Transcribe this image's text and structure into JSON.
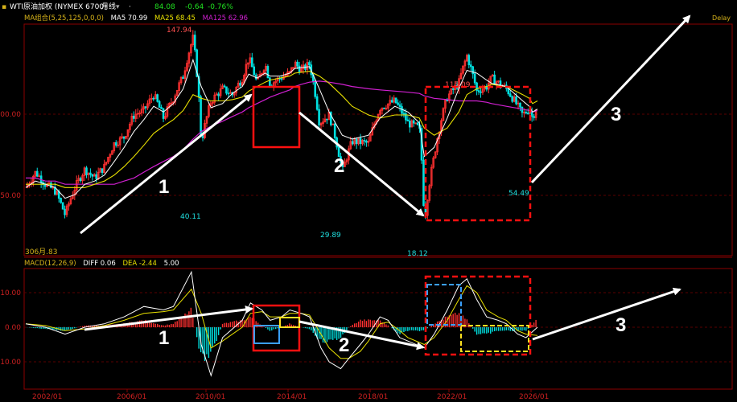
{
  "header": {
    "instrument": "WTI原油加权 (NYMEX 6700)",
    "period": "月线",
    "price": "84.08",
    "change": "-0.64",
    "change_pct": "-0.76%",
    "delay": "Delay"
  },
  "ma_legend": {
    "title": "MA组合(5,25,125,0,0,0)",
    "ma5": "MA5 70.99",
    "ma25": "MA25 68.45",
    "ma125": "MA125 62.96"
  },
  "macd_legend": {
    "title": "MACD(12,26,9)",
    "diff": "DIFF 0.06",
    "dea": "DEA -2.44",
    "macd": "5.00"
  },
  "colors": {
    "up": "#ff3030",
    "down": "#00e0e0",
    "ma5": "#ffffff",
    "ma25": "#e8e000",
    "ma125": "#d020d0",
    "annotation": "#ffffff",
    "box_red": "#ff1010",
    "box_blue": "#3aa0ff",
    "box_yellow": "#ffe020"
  },
  "chart_data": [
    {
      "type": "candlestick",
      "title": "WTI原油加权 月线",
      "yticks": [
        "100.00",
        "50.00"
      ],
      "ylim": [
        13,
        160
      ],
      "xlabels": [
        "2002/01",
        "2006/01",
        "2010/01",
        "2014/01",
        "2018/01",
        "2022/01",
        "2026/01"
      ],
      "price_labels": [
        "147.94",
        "40.11",
        "29.89",
        "18.12",
        "115.09",
        "54.49",
        "306月.83"
      ],
      "annotations": [
        "1",
        "2",
        "3"
      ],
      "x": [
        "2000/01",
        "2000/07",
        "2001/01",
        "2001/07",
        "2002/01",
        "2002/07",
        "2003/01",
        "2003/07",
        "2004/01",
        "2004/07",
        "2005/01",
        "2005/07",
        "2006/01",
        "2006/07",
        "2007/01",
        "2007/07",
        "2008/01",
        "2008/07",
        "2008/12",
        "2009/06",
        "2010/01",
        "2010/07",
        "2011/01",
        "2011/05",
        "2011/10",
        "2012/03",
        "2012/06",
        "2012/12",
        "2013/06",
        "2013/09",
        "2014/01",
        "2014/06",
        "2014/12",
        "2015/06",
        "2016/02",
        "2016/08",
        "2017/06",
        "2018/01",
        "2018/10",
        "2019/06",
        "2020/01",
        "2020/04",
        "2020/10",
        "2021/06",
        "2022/01",
        "2022/06",
        "2022/12",
        "2023/06",
        "2023/09",
        "2024/06",
        "2025/04",
        "2025/08",
        "2025/10",
        "2026/01"
      ],
      "close": [
        27,
        32,
        28,
        26,
        20,
        27,
        33,
        30,
        34,
        44,
        47,
        60,
        63,
        75,
        58,
        72,
        92,
        140,
        44,
        70,
        80,
        75,
        90,
        112,
        85,
        105,
        84,
        90,
        95,
        106,
        98,
        105,
        55,
        60,
        32,
        45,
        44,
        65,
        70,
        55,
        52,
        18,
        38,
        73,
        85,
        115,
        78,
        82,
        90,
        80,
        60,
        64,
        58,
        68
      ],
      "ma5": [
        27,
        29,
        28,
        27,
        24,
        25,
        28,
        29,
        31,
        36,
        42,
        50,
        57,
        66,
        62,
        68,
        80,
        110,
        82,
        65,
        68,
        76,
        82,
        94,
        90,
        95,
        92,
        92,
        95,
        100,
        101,
        102,
        80,
        62,
        48,
        46,
        48,
        58,
        66,
        62,
        55,
        38,
        42,
        58,
        80,
        98,
        95,
        88,
        85,
        82,
        70,
        66,
        62,
        64
      ],
      "ma25": [
        28,
        28,
        28,
        28,
        27,
        27,
        27,
        28,
        29,
        31,
        34,
        38,
        43,
        49,
        53,
        57,
        63,
        75,
        72,
        70,
        70,
        71,
        73,
        78,
        82,
        86,
        88,
        90,
        92,
        95,
        96,
        97,
        92,
        85,
        74,
        66,
        60,
        58,
        60,
        60,
        58,
        52,
        48,
        52,
        62,
        75,
        80,
        82,
        84,
        82,
        75,
        72,
        68,
        70
      ],
      "ma125": [
        30,
        30,
        29,
        29,
        28,
        28,
        28,
        28,
        28,
        28,
        29,
        30,
        32,
        34,
        36,
        38,
        41,
        46,
        50,
        53,
        56,
        59,
        62,
        65,
        68,
        71,
        73,
        76,
        79,
        82,
        84,
        86,
        87,
        86,
        84,
        82,
        80,
        79,
        78,
        77,
        76,
        74,
        72,
        71,
        70,
        70,
        70,
        69,
        68,
        66,
        64,
        63,
        62,
        63
      ]
    },
    {
      "type": "macd",
      "title": "MACD(12,26,9)",
      "yticks": [
        "10.00",
        "0.00",
        "-10.00"
      ],
      "ylim": [
        -18,
        18
      ],
      "annotations": [
        "1",
        "2",
        "3"
      ],
      "x": [
        "2000/01",
        "2001/01",
        "2002/01",
        "2003/01",
        "2004/01",
        "2005/01",
        "2006/01",
        "2007/01",
        "2007/07",
        "2008/06",
        "2008/12",
        "2009/06",
        "2010/01",
        "2011/01",
        "2011/06",
        "2012/01",
        "2012/06",
        "2013/01",
        "2013/06",
        "2014/01",
        "2014/06",
        "2015/01",
        "2015/06",
        "2016/01",
        "2016/06",
        "2017/01",
        "2017/06",
        "2018/01",
        "2018/06",
        "2019/01",
        "2019/06",
        "2020/04",
        "2020/10",
        "2021/06",
        "2022/01",
        "2022/06",
        "2022/12",
        "2023/06",
        "2024/01",
        "2024/06",
        "2025/01",
        "2025/06",
        "2026/01"
      ],
      "diff": [
        1,
        0,
        -2,
        0,
        1,
        3,
        6,
        5,
        6,
        16,
        -5,
        -14,
        -3,
        2,
        7,
        5,
        2,
        3,
        5,
        4,
        3,
        -6,
        -10,
        -12,
        -9,
        -5,
        -2,
        3,
        2,
        -3,
        -4,
        -6,
        -2,
        5,
        12,
        14,
        8,
        3,
        2,
        1,
        -2,
        -3,
        0
      ],
      "dea": [
        1,
        0.5,
        -1,
        -0.5,
        0.5,
        2,
        4,
        4.5,
        5,
        11,
        4,
        -6,
        -4,
        0,
        4,
        4.5,
        3,
        3,
        4,
        4,
        3.5,
        -2,
        -6,
        -9,
        -9,
        -7,
        -4,
        1,
        1.5,
        -1,
        -3,
        -5,
        -3,
        2,
        8,
        12,
        10,
        5,
        3,
        2,
        -1,
        -2,
        -2.4
      ],
      "hist": [
        0,
        -0.5,
        -1,
        0.5,
        0.5,
        1,
        2,
        0.5,
        1,
        5,
        -9,
        -8,
        1,
        2,
        3,
        0.5,
        -1,
        0,
        1,
        0,
        -0.5,
        -4,
        -4,
        -3,
        0,
        2,
        2,
        2,
        0.5,
        -2,
        -1,
        -1,
        1,
        3,
        4,
        2,
        -2,
        -2,
        -1,
        -1,
        -1,
        -1,
        2.4
      ],
      "macd_value": 5.0
    }
  ]
}
